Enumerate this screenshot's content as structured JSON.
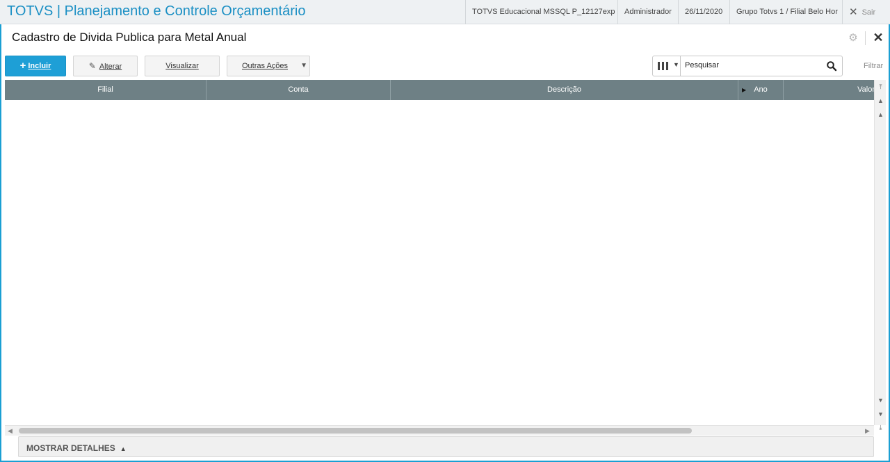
{
  "header": {
    "app_title": "TOTVS | Planejamento e Controle Orçamentário",
    "environment": "TOTVS Educacional MSSQL P_12127exp",
    "user": "Administrador",
    "date": "26/11/2020",
    "branch": "Grupo Totvs 1 / Filial Belo Hor",
    "logout_label": "Sair"
  },
  "page": {
    "title": "Cadastro de Divida Publica para Metal Anual"
  },
  "toolbar": {
    "include_label": "Incluir",
    "edit_label": "Alterar",
    "view_label": "Visualizar",
    "other_actions_label": "Outras Ações"
  },
  "search": {
    "placeholder": "Pesquisar",
    "filter_label": "Filtrar"
  },
  "grid": {
    "columns": [
      "Filial",
      "Conta",
      "Descrição",
      "Ano",
      "Valor"
    ],
    "rows": []
  },
  "footer": {
    "details_label": "MOSTRAR DETALHES"
  },
  "colors": {
    "accent": "#1e9fd6",
    "header_grid": "#6e8085",
    "title_blue": "#1a8fc4"
  }
}
